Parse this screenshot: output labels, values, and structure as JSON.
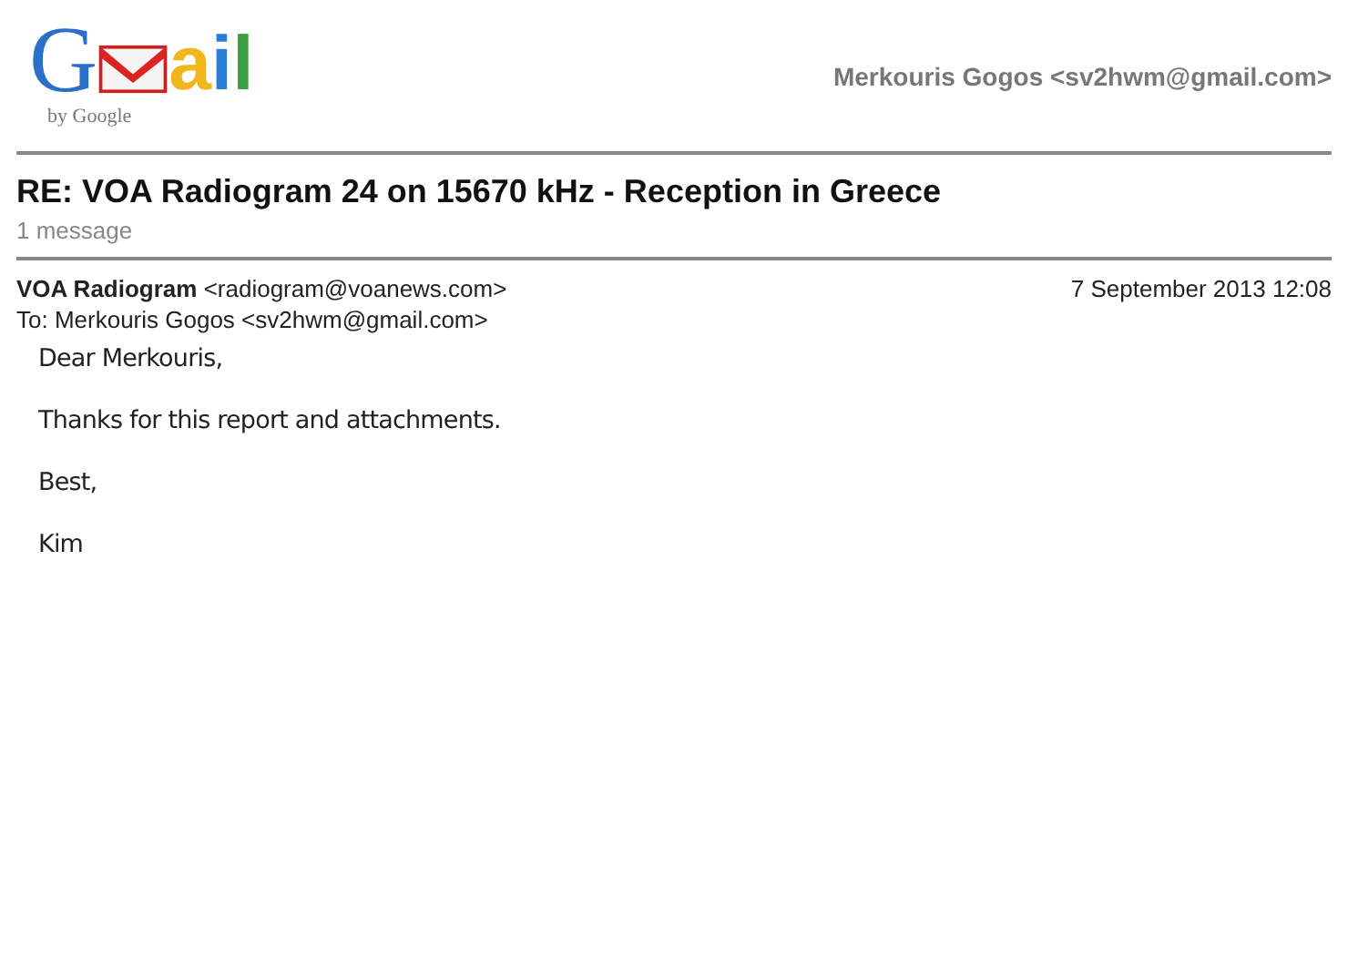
{
  "logo": {
    "before": "G",
    "after": "ail",
    "byline": "by Google"
  },
  "account": "Merkouris Gogos <sv2hwm@gmail.com>",
  "thread": {
    "subject": "RE: VOA Radiogram 24 on 15670 kHz - Reception in Greece",
    "count": "1 message"
  },
  "message": {
    "sender_name": "VOA Radiogram",
    "sender_email": "<radiogram@voanews.com>",
    "date": "7 September 2013 12:08",
    "to": "To: Merkouris Gogos <sv2hwm@gmail.com>",
    "body": [
      "Dear Merkouris,",
      "Thanks for this report and attachments.",
      "Best,",
      "Kim"
    ]
  }
}
